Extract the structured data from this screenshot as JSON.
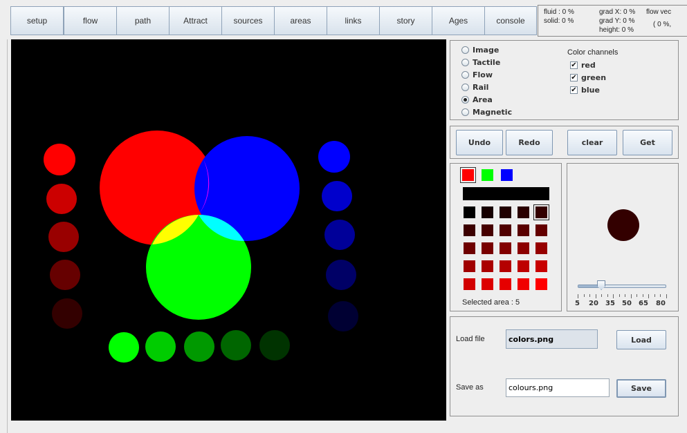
{
  "tabs": [
    "setup",
    "flow",
    "path",
    "Attract",
    "sources",
    "areas",
    "links",
    "story",
    "Ages",
    "console"
  ],
  "status": {
    "fluid": "fluid :  0 %",
    "solid": "solid:  0 %",
    "grad_x": "grad X:  0 %",
    "grad_y": "grad Y:  0 %",
    "height": "height:  0 %",
    "flow_vec": "flow vec",
    "flow_pct": "(  0 %,"
  },
  "modes": [
    {
      "label": "Image",
      "selected": false
    },
    {
      "label": "Tactile",
      "selected": false
    },
    {
      "label": "Flow",
      "selected": false
    },
    {
      "label": "Rail",
      "selected": false
    },
    {
      "label": "Area",
      "selected": true
    },
    {
      "label": "Magnetic",
      "selected": false
    }
  ],
  "color_channels": {
    "title": "Color channels",
    "items": [
      {
        "label": "red",
        "checked": true
      },
      {
        "label": "green",
        "checked": true
      },
      {
        "label": "blue",
        "checked": true
      }
    ]
  },
  "actions": {
    "undo": "Undo",
    "redo": "Redo",
    "clear": "clear",
    "get": "Get"
  },
  "palette": {
    "primary": [
      "#ff0000",
      "#00ff00",
      "#0000ff"
    ],
    "bar_color": "#000000",
    "grid": [
      [
        "#000000",
        "#160000",
        "#200000",
        "#2a0000",
        "#330000"
      ],
      [
        "#3c0000",
        "#460000",
        "#500000",
        "#5a0000",
        "#640000"
      ],
      [
        "#6e0000",
        "#780000",
        "#820000",
        "#8c0000",
        "#960000"
      ],
      [
        "#a00000",
        "#aa0000",
        "#b40000",
        "#be0000",
        "#c80000"
      ],
      [
        "#d20000",
        "#dc0000",
        "#e60000",
        "#f00000",
        "#ff0000"
      ]
    ],
    "selected_label": "Selected area : 5"
  },
  "preview": {
    "color": "#330000"
  },
  "brush_slider": {
    "value": 25,
    "min": 5,
    "max": 80,
    "labels": [
      "5",
      "20",
      "35",
      "50",
      "65",
      "80"
    ]
  },
  "file": {
    "load_label": "Load file",
    "load_value": "colors.png",
    "load_button": "Load",
    "save_label": "Save as",
    "save_value": "colours.png",
    "save_button": "Save"
  },
  "canvas": {
    "background": "#000000"
  }
}
